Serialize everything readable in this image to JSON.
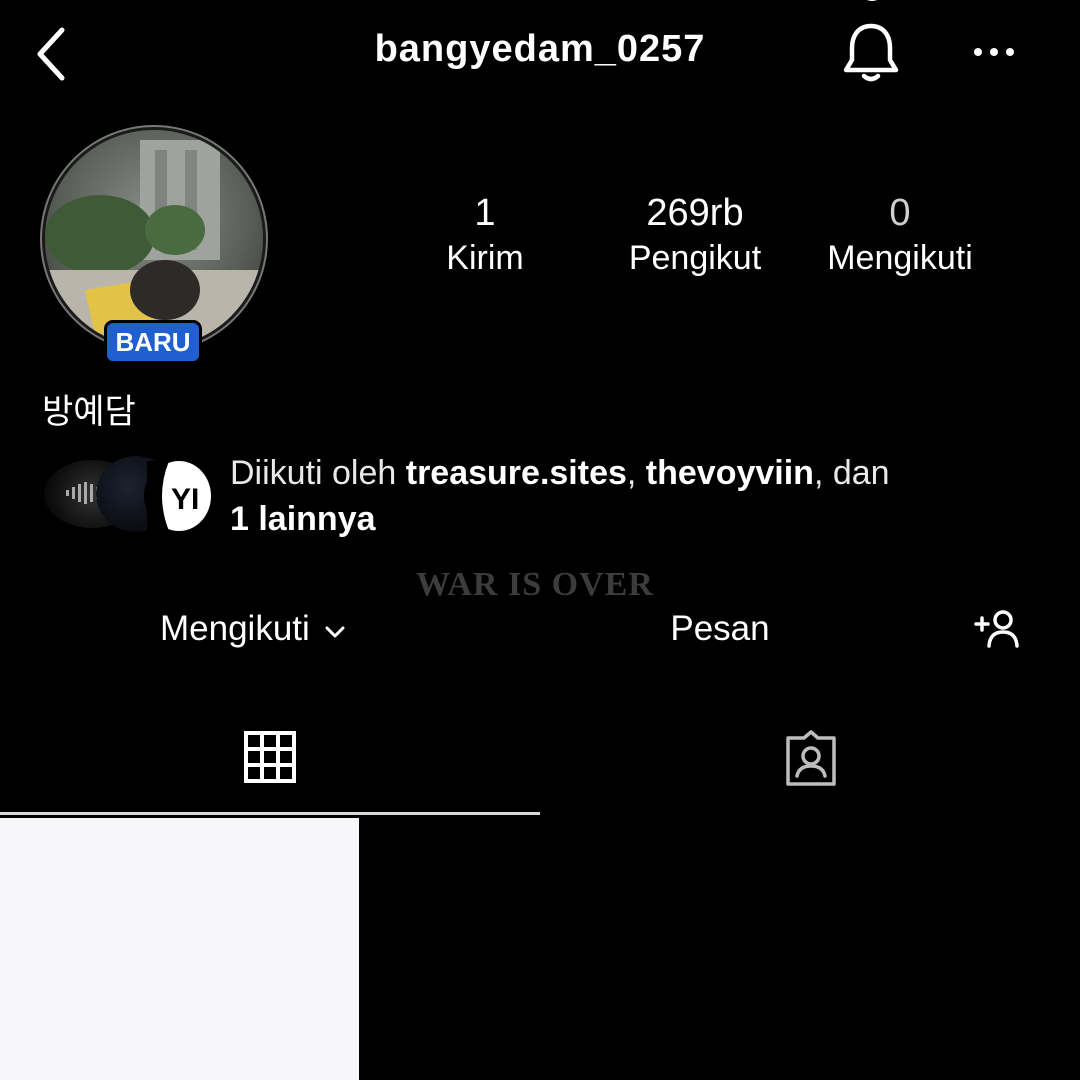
{
  "header": {
    "username": "bangyedam_0257"
  },
  "profile": {
    "badge": "BARU",
    "display_name": "방예담",
    "stats": [
      {
        "value": "1",
        "label": "Kirim"
      },
      {
        "value": "269rb",
        "label": "Pengikut"
      },
      {
        "value": "0",
        "label": "Mengikuti"
      }
    ]
  },
  "followed_by": {
    "prefix": "Diikuti oleh ",
    "user1": "treasure.sites",
    "sep": ", ",
    "user2": "thevoyviin",
    "suffix": ", dan",
    "line2": "1 lainnya"
  },
  "overlay": {
    "text": "WAR IS OVER"
  },
  "actions": {
    "follow_label": "Mengikuti",
    "message_label": "Pesan"
  },
  "tabs": {
    "active": "grid"
  },
  "icons": {
    "back": "back-icon",
    "bell": "bell-icon",
    "more": "more-icon",
    "add_user": "add-user-icon",
    "grid": "grid-icon",
    "tagged": "tagged-icon"
  },
  "colors": {
    "background": "#000000",
    "badge": "#1f5fcf",
    "text": "#ffffff"
  }
}
